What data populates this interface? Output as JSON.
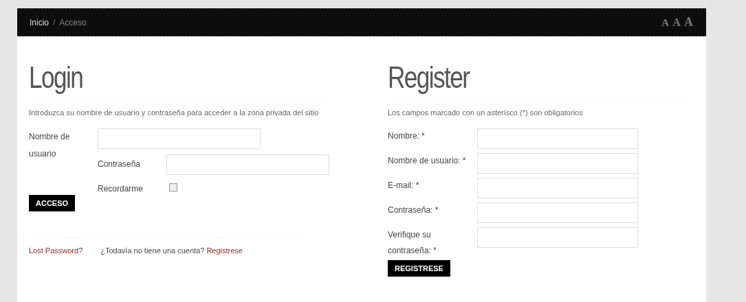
{
  "breadcrumb": [
    {
      "label": "Inicio",
      "current": false
    },
    {
      "label": "Acceso",
      "current": true
    }
  ],
  "breadcrumb_separator": "/",
  "font_size_controls": [
    "A",
    "A",
    "A"
  ],
  "login": {
    "title": "Login",
    "intro": "Introduzca su nombre de usuario y contraseña para acceder a la zona privada del sitio",
    "username_label": "Nombre de usuario",
    "password_label": "Contraseña",
    "remember_label": "Recordarme",
    "remember_checked": false,
    "button": "ACCESO",
    "lost_password": "Lost Password?",
    "no_account": "¿Todavía no tiene una cuenta?",
    "register_link": "Registrese"
  },
  "register": {
    "title": "Register",
    "intro": "Los campos marcado con un asterísco (*) son obligatorios",
    "fields": [
      {
        "label": "Nombre: *"
      },
      {
        "label": "Nombre de usuario: *"
      },
      {
        "label": "E-mail: *"
      },
      {
        "label": "Contraseña: *"
      },
      {
        "label": "Verifique su contraseña: *"
      }
    ],
    "button": "REGISTRESE"
  }
}
